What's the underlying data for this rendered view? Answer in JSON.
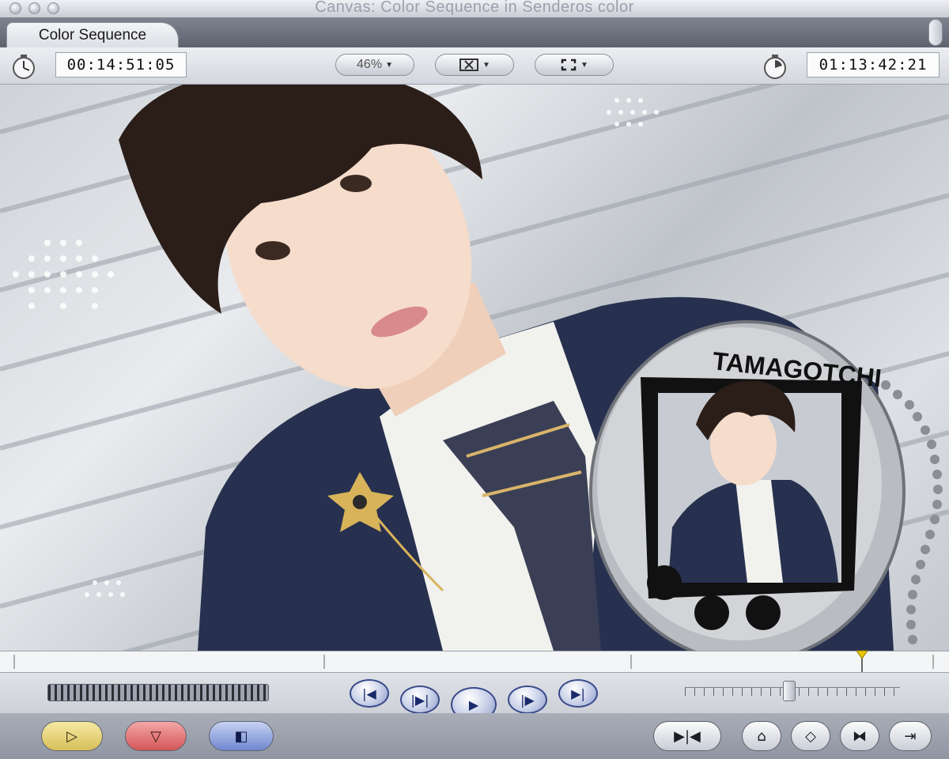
{
  "window": {
    "title": "Canvas: Color Sequence in Senderos color"
  },
  "tabs": [
    {
      "label": "Color Sequence",
      "active": true
    }
  ],
  "toolbar": {
    "current_timecode": "00:14:51:05",
    "zoom_label": "46%",
    "view_icon": "overlay-view-icon",
    "fit_icon": "fit-frame-icon",
    "duration_timecode": "01:13:42:21"
  },
  "canvas": {
    "tamagotchi_brand": "TAMAGOTCHI"
  },
  "transport": {
    "buttons": [
      {
        "name": "go-to-previous-edit",
        "icon": "prev-edit-icon",
        "glyph": "|◀"
      },
      {
        "name": "play-in-to-out",
        "icon": "play-in-out-icon",
        "glyph": "|▶|"
      },
      {
        "name": "play",
        "icon": "play-icon",
        "glyph": "▶"
      },
      {
        "name": "play-around",
        "icon": "play-around-icon",
        "glyph": "|▶"
      },
      {
        "name": "go-to-next-edit",
        "icon": "next-edit-icon",
        "glyph": "▶|"
      }
    ]
  },
  "edit_buttons": [
    {
      "name": "insert-button",
      "glyph": "▷",
      "color": "#e8d67a"
    },
    {
      "name": "overwrite-button",
      "glyph": "▽",
      "color": "#e06a6a"
    },
    {
      "name": "replace-button",
      "glyph": "◧",
      "color": "#7b93d6"
    }
  ],
  "marker_buttons": [
    {
      "name": "mark-in-out-button",
      "glyph": "▶|◀"
    },
    {
      "name": "add-marker-button",
      "glyph": "⌂"
    },
    {
      "name": "add-keyframe-button",
      "glyph": "◇"
    },
    {
      "name": "match-frame-button",
      "glyph": "⧓"
    },
    {
      "name": "export-button",
      "glyph": "⇥"
    }
  ],
  "colors": {
    "accent": "#3a4a8a",
    "playhead": "#e8c800"
  }
}
